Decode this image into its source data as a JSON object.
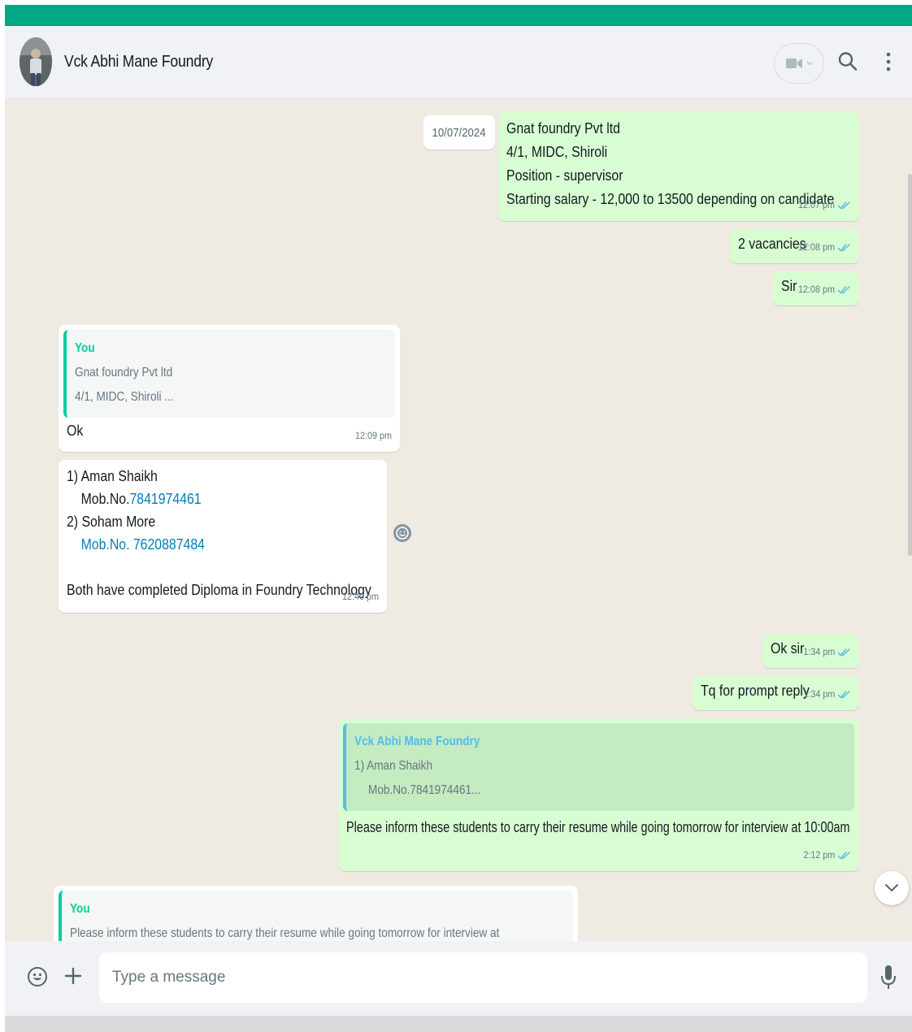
{
  "header": {
    "contact_name": "Vck Abhi Mane Foundry"
  },
  "date_chip": "10/07/2024",
  "messages": {
    "m1": {
      "lines": [
        "Gnat foundry Pvt ltd",
        "4/1, MIDC, Shiroli",
        "Position - supervisor",
        "Starting salary - 12,000 to 13500 depending on candidate"
      ],
      "time": "12:07 pm"
    },
    "m2": {
      "text": "2 vacancies",
      "time": "12:08 pm"
    },
    "m3": {
      "text": "Sir",
      "time": "12:08 pm"
    },
    "m4": {
      "quote_author": "You",
      "quote_lines": [
        "Gnat foundry Pvt ltd",
        "4/1, MIDC, Shiroli ..."
      ],
      "text": "Ok",
      "time": "12:09 pm"
    },
    "m5": {
      "line1": "1) Aman Shaikh",
      "line2_prefix": "Mob.No.",
      "line2_phone": "7841974461",
      "line3": "2) Soham More",
      "line4_phone": "Mob.No. 7620887484",
      "line6": "Both have completed Diploma in Foundry Technology",
      "time": "12:40 pm"
    },
    "m6": {
      "text": "Ok sir",
      "time": "1:34 pm"
    },
    "m7": {
      "text": "Tq for prompt reply",
      "time": "1:34 pm"
    },
    "m8": {
      "quote_author": "Vck Abhi Mane Foundry",
      "quote_lines": [
        "1) Aman Shaikh",
        "Mob.No.7841974461..."
      ],
      "text": "Please inform these students to carry their resume while going tomorrow for interview at 10:00am",
      "time": "2:12 pm"
    },
    "m9": {
      "quote_author": "You",
      "quote_line": "Please inform these students to carry their resume while going tomorrow for interview at"
    }
  },
  "composer": {
    "placeholder": "Type a message"
  },
  "colors": {
    "accent": "#00a884",
    "outgoing_bubble": "#d9fdd3",
    "incoming_bubble": "#ffffff",
    "chat_background": "#efeae2",
    "read_ticks": "#53bdeb",
    "link": "#027eb5"
  }
}
